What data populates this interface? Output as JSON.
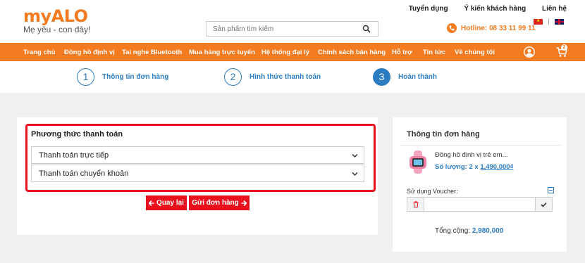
{
  "header": {
    "logo_text": "myALO",
    "tagline": "Mẹ yêu - con đây!",
    "search_placeholder": "Sản phẩm tìm kiếm",
    "top_links": [
      "Tuyển dụng",
      "Ý kiến khách hàng",
      "Liên hệ"
    ],
    "hotline": "Hotline: 08 33 11 99 11"
  },
  "nav": {
    "items": [
      "Trang chủ",
      "Đồng hồ định vị",
      "Tai nghe Bluetooth",
      "Mua hàng trực tuyến",
      "Hệ thống đại lý",
      "Chính sách bán hàng",
      "Hỗ trợ",
      "Tin tức",
      "Về chúng tôi"
    ],
    "cart_count": "2"
  },
  "steps": [
    {
      "num": "1",
      "label": "Thông tin đơn hàng"
    },
    {
      "num": "2",
      "label": "Hình thức thanh toán"
    },
    {
      "num": "3",
      "label": "Hoàn thành"
    }
  ],
  "payment": {
    "title": "Phương thức thanh toán",
    "options": [
      "Thanh toán trực tiếp",
      "Thanh toán chuyển khoản"
    ],
    "back_label": "Quay lại",
    "submit_label": "Gửi đơn hàng"
  },
  "summary": {
    "title": "Thông tin đơn hàng",
    "product_name": "Đồng hồ định vị trẻ em...",
    "qty_label": "Số lượng: 2 x ",
    "qty_price": "1,490,000₫",
    "voucher_label": "Sử dụng Voucher:",
    "voucher_value": "",
    "total_label": "Tổng cộng: ",
    "total_value": "2,980,000"
  },
  "colors": {
    "brand_orange": "#f47b20",
    "accent_blue": "#2b7cc1",
    "alert_red": "#e8101c"
  }
}
